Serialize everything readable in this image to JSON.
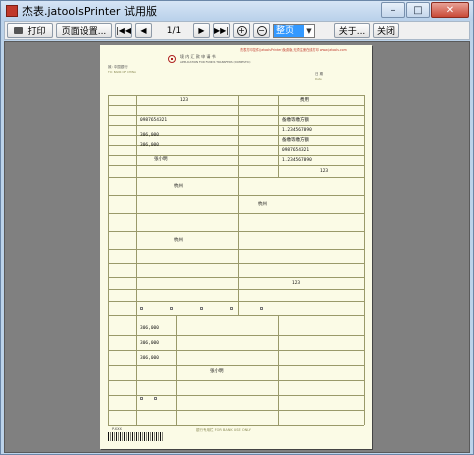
{
  "window": {
    "title": "杰表.jatoolsPrinter 试用版",
    "controls": {
      "minimize": "–",
      "maximize": "□",
      "close": "✕"
    }
  },
  "toolbar": {
    "print_label": "打印",
    "page_setup_label": "页面设置...",
    "first_label": "|◀◀",
    "prev_label": "◀",
    "page_indicator": "1/1",
    "next_label": "▶",
    "last_label": "▶▶|",
    "zoom_in_label": "+",
    "zoom_out_label": "−",
    "zoom_value": "整页",
    "about_label": "关于...",
    "close_label": "关闭"
  },
  "document": {
    "bank_title": "境 内 汇 款 申 请 书",
    "bank_subtitle": "APPLICATION FOR FUNDS TRANSFERS (DOMESTIC)",
    "red_notice_1": "杰表打印控件(jatoolsPrinter)免费版,无须注册在线打印 www.jatools.com",
    "to_label": "致: 中国银行",
    "to_label_en": "TO: BANK OF CHINA",
    "date_label": "日 期",
    "date_label_en": "Date",
    "amount_value_1": "123",
    "name_value": "费用",
    "account_value_1": "0987654321",
    "currency_value": "备缴等缴方额",
    "account_value_2": "1.234567890",
    "amount_value_2": "306,000",
    "bank_value": "备缴等缴方额",
    "account_value_3": "0987654321",
    "remit_value": "306,000",
    "ref_value": "1.234567890",
    "applicant_value": "张小明",
    "amount_value_3": "123",
    "payee_bank_1": "杭州",
    "payee_bank_2": "杭州",
    "payee_bank_3": "杭州",
    "amount_value_4": "123",
    "fee_value_1": "306,000",
    "fee_value_2": "306,000",
    "fee_value_3": "306,000",
    "signer_value": "张小明",
    "footer_note": "银行专用栏 FOR BANK USE ONLY",
    "form_code": "P.XXX"
  }
}
